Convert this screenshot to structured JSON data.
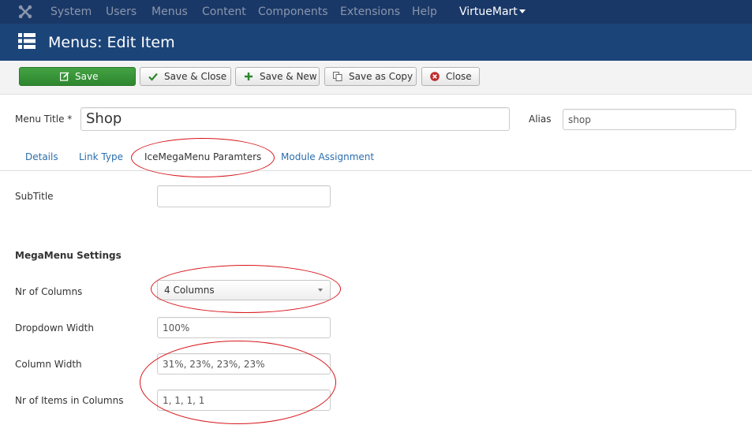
{
  "topnav": {
    "logo_icon": "joomla-logo-icon",
    "items": [
      "System",
      "Users",
      "Menus",
      "Content",
      "Components",
      "Extensions",
      "Help",
      "VirtueMart"
    ]
  },
  "header": {
    "icon": "list-icon",
    "title": "Menus: Edit Item"
  },
  "toolbar": {
    "save": "Save",
    "save_close": "Save & Close",
    "save_new": "Save & New",
    "save_copy": "Save as Copy",
    "close": "Close"
  },
  "form": {
    "menu_title_label": "Menu Title *",
    "menu_title_value": "Shop",
    "alias_label": "Alias",
    "alias_value": "shop"
  },
  "tabs": [
    "Details",
    "Link Type",
    "IceMegaMenu Paramters",
    "Module Assignment"
  ],
  "active_tab": "IceMegaMenu Paramters",
  "params": {
    "subtitle_label": "SubTitle",
    "subtitle_value": "",
    "section_heading": "MegaMenu Settings",
    "columns_label": "Nr of Columns",
    "columns_value": "4 Columns",
    "dropdown_width_label": "Dropdown Width",
    "dropdown_width_value": "100%",
    "column_width_label": "Column Width",
    "column_width_value": "31%, 23%, 23%, 23%",
    "items_label": "Nr of Items in Columns",
    "items_value": "1, 1, 1, 1"
  },
  "colors": {
    "topnav_bg": "#1a3867",
    "header_bg": "#1b4479",
    "save_green": "#359335",
    "annotation_red": "#d8141a",
    "link_blue": "#2a6eac"
  }
}
